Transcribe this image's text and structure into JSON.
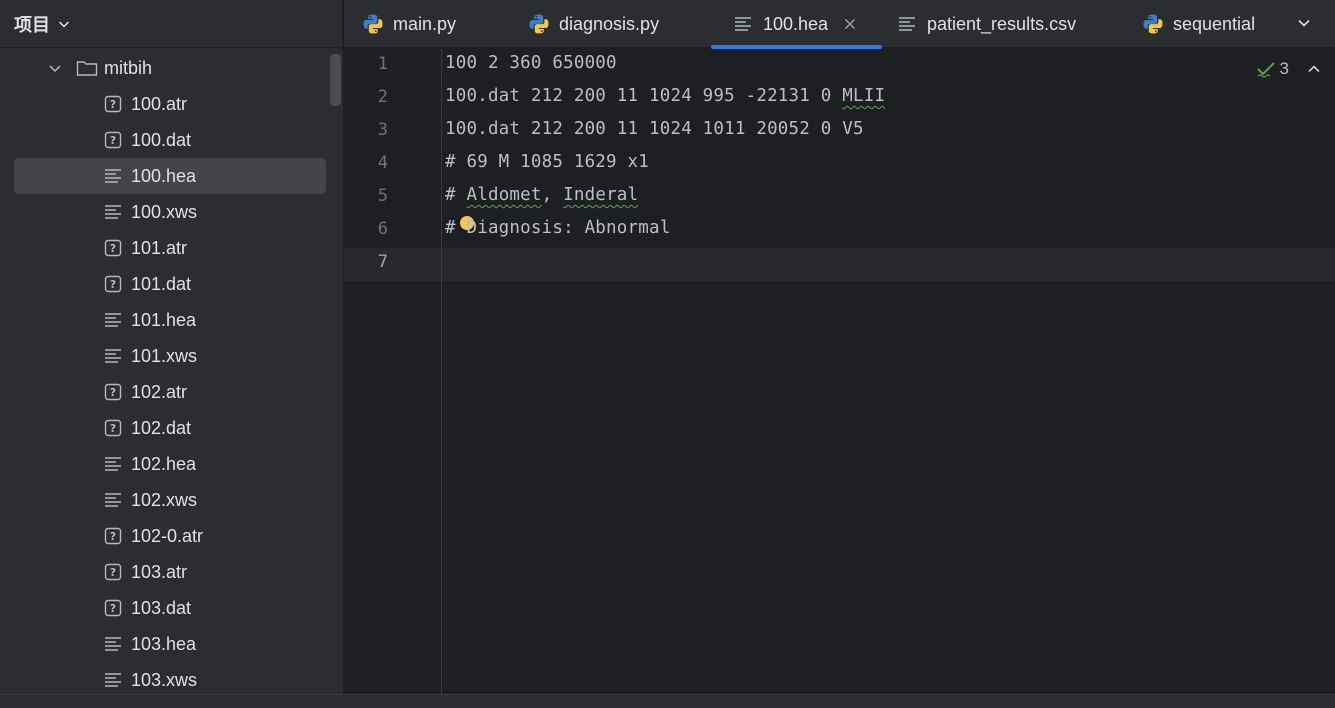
{
  "panel": {
    "title": "项目"
  },
  "tree": {
    "folder": "mitbih",
    "files": [
      {
        "name": "100.atr",
        "icon": "unknown-file-icon"
      },
      {
        "name": "100.dat",
        "icon": "unknown-file-icon"
      },
      {
        "name": "100.hea",
        "icon": "text-file-icon",
        "selected": true
      },
      {
        "name": "100.xws",
        "icon": "text-file-icon"
      },
      {
        "name": "101.atr",
        "icon": "unknown-file-icon"
      },
      {
        "name": "101.dat",
        "icon": "unknown-file-icon"
      },
      {
        "name": "101.hea",
        "icon": "text-file-icon"
      },
      {
        "name": "101.xws",
        "icon": "text-file-icon"
      },
      {
        "name": "102.atr",
        "icon": "unknown-file-icon"
      },
      {
        "name": "102.dat",
        "icon": "unknown-file-icon"
      },
      {
        "name": "102.hea",
        "icon": "text-file-icon"
      },
      {
        "name": "102.xws",
        "icon": "text-file-icon"
      },
      {
        "name": "102-0.atr",
        "icon": "unknown-file-icon"
      },
      {
        "name": "103.atr",
        "icon": "unknown-file-icon"
      },
      {
        "name": "103.dat",
        "icon": "unknown-file-icon"
      },
      {
        "name": "103.hea",
        "icon": "text-file-icon"
      },
      {
        "name": "103.xws",
        "icon": "text-file-icon"
      }
    ]
  },
  "tabs": [
    {
      "label": "main.py",
      "icon": "python-icon"
    },
    {
      "label": "diagnosis.py",
      "icon": "python-icon"
    },
    {
      "label": "100.hea",
      "icon": "text-file-icon",
      "active": true
    },
    {
      "label": "patient_results.csv",
      "icon": "text-file-icon"
    },
    {
      "label": "sequential",
      "icon": "python-icon"
    }
  ],
  "editor": {
    "inspection_count": "3",
    "line_numbers": [
      "1",
      "2",
      "3",
      "4",
      "5",
      "6",
      "7"
    ],
    "lines": [
      "100 2 360 650000",
      "100.dat 212 200 11 1024 995 -22131 0 ",
      "100.dat 212 200 11 1024 1011 20052 0 V5",
      "# 69 M 1085 1629 x1",
      "# ",
      "# Diagnosis: Abnormal",
      ""
    ],
    "squiggle_words": {
      "line2": "MLII",
      "line5_a": "Aldomet",
      "line5_sep": ", ",
      "line5_b": "Inderal"
    },
    "current_line": 7
  },
  "colors": {
    "accent": "#3574f0",
    "bulb": "#f2c55c",
    "check": "#5fa34f"
  }
}
